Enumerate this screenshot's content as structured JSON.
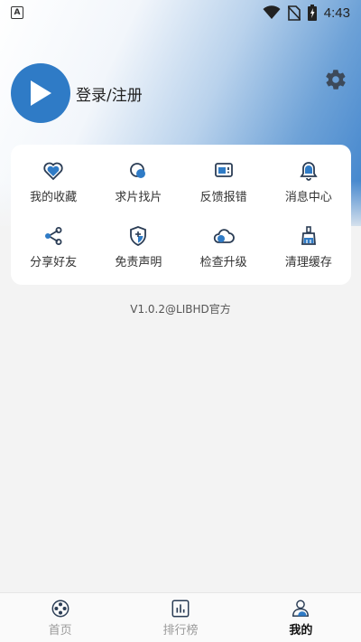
{
  "status_bar": {
    "app_icon_letter": "A",
    "time": "4:43"
  },
  "profile": {
    "login_label": "登录/注册"
  },
  "menu": {
    "items": [
      {
        "label": "我的收藏",
        "icon": "heart-icon"
      },
      {
        "label": "求片找片",
        "icon": "search-film-icon"
      },
      {
        "label": "反馈报错",
        "icon": "feedback-icon"
      },
      {
        "label": "消息中心",
        "icon": "bell-icon"
      },
      {
        "label": "分享好友",
        "icon": "share-icon"
      },
      {
        "label": "免责声明",
        "icon": "shield-icon"
      },
      {
        "label": "检查升级",
        "icon": "cloud-upgrade-icon"
      },
      {
        "label": "清理缓存",
        "icon": "broom-icon"
      }
    ]
  },
  "version_text": "V1.0.2@LIBHD官方",
  "bottom_nav": {
    "items": [
      {
        "label": "首页",
        "icon": "film-reel-icon",
        "active": false
      },
      {
        "label": "排行榜",
        "icon": "chart-icon",
        "active": false
      },
      {
        "label": "我的",
        "icon": "user-icon",
        "active": true
      }
    ]
  },
  "colors": {
    "accent": "#2f7bc6",
    "icon_dark": "#2b3d55",
    "background": "#f3f3f3"
  }
}
